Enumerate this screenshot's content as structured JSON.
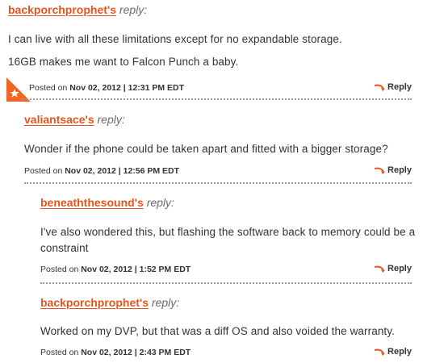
{
  "comments": [
    {
      "author": "backporchprophet's",
      "reply_word": "reply:",
      "lines": [
        "I can live with all these limitations except for no expandable storage.",
        "16GB makes me want to Falcon Punch a baby."
      ],
      "posted_prefix": "Posted on",
      "posted_date": "Nov 02, 2012 | 12:31 PM EDT",
      "reply_label": "Reply",
      "badge_icon": "star-icon"
    },
    {
      "author": "valiantsace's",
      "reply_word": "reply:",
      "lines": [
        "Wonder if the phone could be taken apart and fitted with a bigger storage?"
      ],
      "posted_prefix": "Posted on",
      "posted_date": "Nov 02, 2012 | 12:56 PM EDT",
      "reply_label": "Reply"
    },
    {
      "author": "beneaththesound's",
      "reply_word": "reply:",
      "lines": [
        "I've also wondered this, but flashing the software back to memory could be a",
        "constraint"
      ],
      "posted_prefix": "Posted on",
      "posted_date": "Nov 02, 2012 | 1:52 PM EDT",
      "reply_label": "Reply"
    },
    {
      "author": "backporchprophet's",
      "reply_word": "reply:",
      "lines": [
        "Worked on my DVP, but that was a diff OS and also voided the warranty."
      ],
      "posted_prefix": "Posted on",
      "posted_date": "Nov 02, 2012 | 2:43 PM EDT",
      "reply_label": "Reply"
    }
  ],
  "colors": {
    "author": "#e8541c",
    "badge": "#f26522",
    "dots": "#9a9a9a"
  }
}
